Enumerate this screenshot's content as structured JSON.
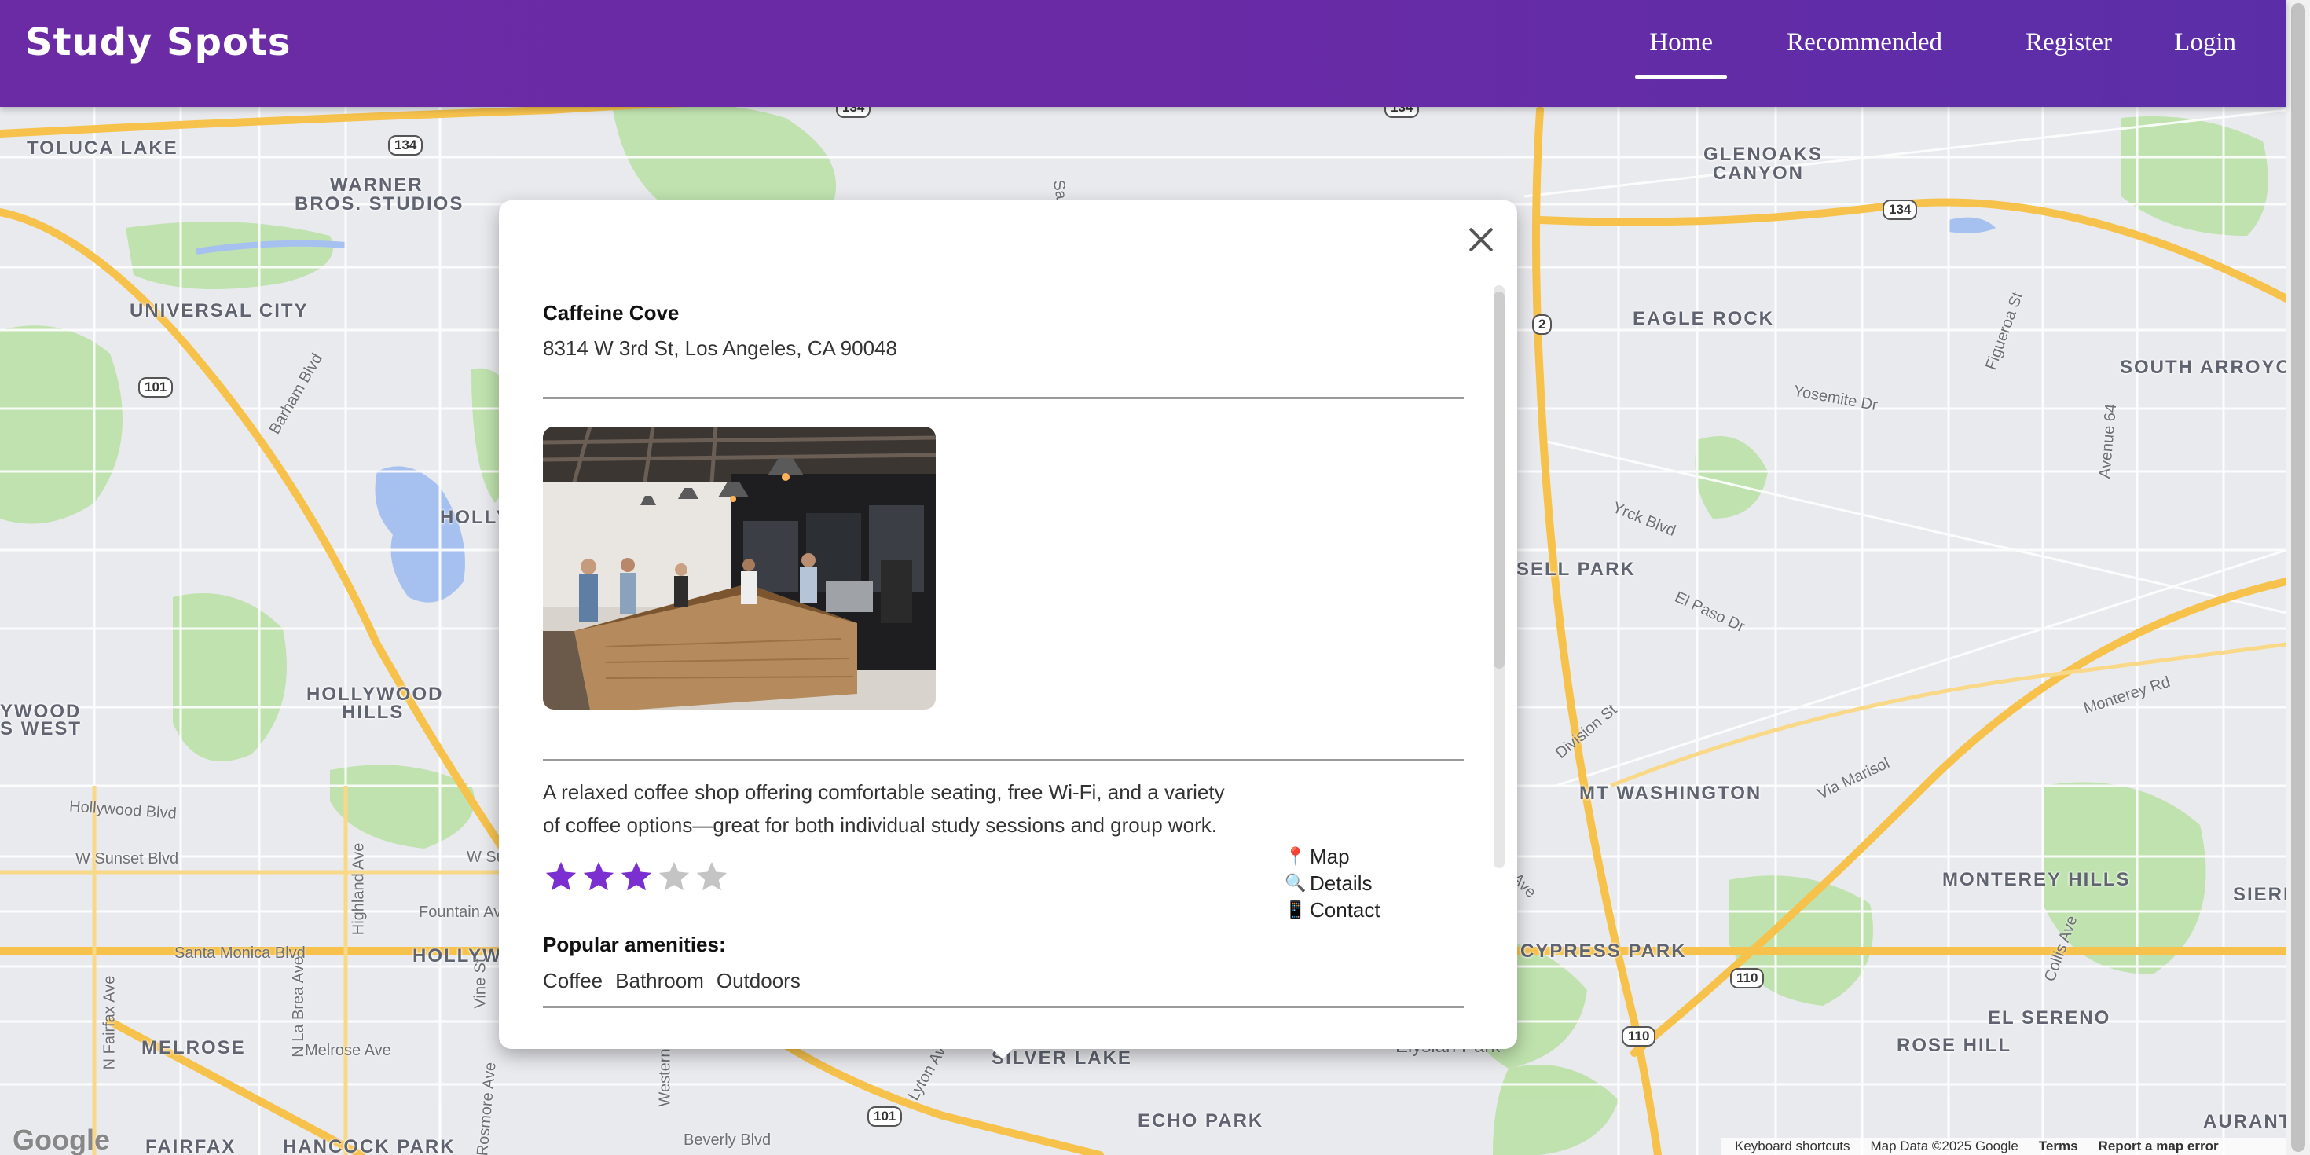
{
  "app": {
    "brand": "Study Spots",
    "nav": [
      {
        "label": "Home",
        "active": true
      },
      {
        "label": "Recommended",
        "active": false
      },
      {
        "label": "Register",
        "active": false
      },
      {
        "label": "Login",
        "active": false
      }
    ]
  },
  "map": {
    "labels": [
      "TOLUCA LAKE",
      "WARNER",
      "BROS. STUDIOS",
      "UNIVERSAL CITY",
      "HOLLY",
      "HOLLYWOOD",
      "HILLS",
      "YWOOD",
      "S WEST",
      "GLENOAKS",
      "CANYON",
      "EAGLE ROCK",
      "SOUTH ARROYO",
      "SELL PARK",
      "MT WASHINGTON",
      "CYPRESS PARK",
      "MONTEREY HILLS",
      "SIERR",
      "EL SERENO",
      "ROSE HILL",
      "MELROSE",
      "HOLLYWO",
      "SILVER LAKE",
      "ECHO PARK",
      "FAIRFAX",
      "HANCOCK PARK",
      "AURANT"
    ],
    "streets": [
      "Barham Blvd",
      "Hollywood Blvd",
      "W Sunset Blvd",
      "Santa Monica Blvd",
      "Melrose Ave",
      "Fountain Av",
      "Highland Ave",
      "N La Brea Ave",
      "N Fairfax Ave",
      "Vine St",
      "Yosemite Dr",
      "Yrck Blvd",
      "El Paso Dr",
      "Division St",
      "Via Marisol",
      "Monterey Rd",
      "Avenue 64",
      "Figueroa St",
      "Collis Ave",
      "Beverly Blvd",
      "Rosmore Ave",
      "Western",
      "Lyton Ave",
      "Elysian Park",
      "Ave",
      "Sa",
      "W Su"
    ],
    "shields": [
      "134",
      "134",
      "134",
      "101",
      "101",
      "2",
      "134",
      "110",
      "110",
      "101"
    ],
    "attribution": {
      "logo": "Google",
      "keyboard": "Keyboard shortcuts",
      "data": "Map Data ©2025 Google",
      "terms": "Terms",
      "report": "Report a map error"
    }
  },
  "place": {
    "name": "Caffeine Cove",
    "address": "8314 W 3rd St, Los Angeles, CA 90048",
    "description": "A relaxed coffee shop offering comfortable seating, free Wi-Fi, and a variety of coffee options—great for both individual study sessions and group work.",
    "rating": 3,
    "rating_max": 5,
    "links": [
      {
        "icon": "map-pin-icon",
        "glyph": "📍",
        "label": "Map"
      },
      {
        "icon": "magnifier-icon",
        "glyph": "🔍",
        "label": "Details"
      },
      {
        "icon": "phone-icon",
        "glyph": "📱",
        "label": "Contact"
      }
    ],
    "amenities_title": "Popular amenities:",
    "amenities": [
      "Coffee",
      "Bathroom",
      "Outdoors"
    ]
  },
  "colors": {
    "header": "#6a2aa6",
    "star_filled": "#7b2fd0",
    "star_empty": "#c4c4c4",
    "map_bg": "#e8eaed",
    "park": "#b8dfa5",
    "water": "#a6c1f0",
    "freeway": "#f7c552"
  }
}
